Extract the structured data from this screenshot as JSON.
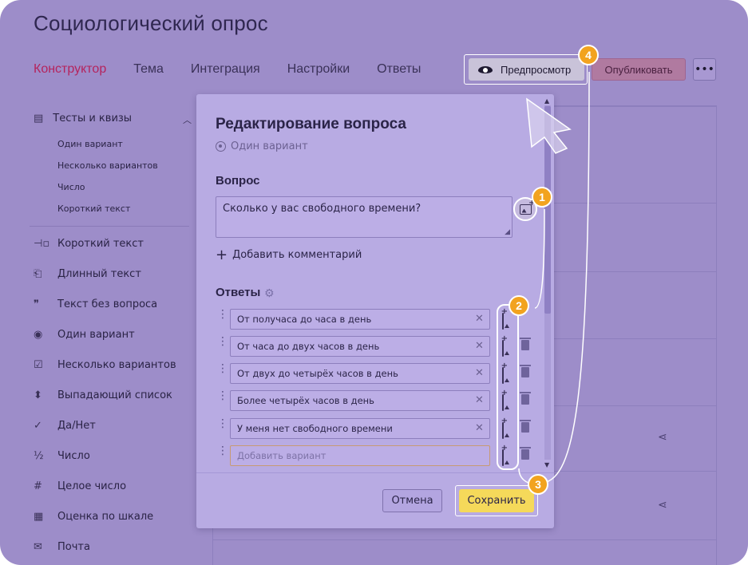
{
  "app": {
    "title": "Социологический опрос"
  },
  "tabs": [
    {
      "label": "Конструктор",
      "active": true
    },
    {
      "label": "Тема"
    },
    {
      "label": "Интеграция"
    },
    {
      "label": "Настройки"
    },
    {
      "label": "Ответы"
    }
  ],
  "toolbar": {
    "preview_label": "Предпросмотр",
    "publish_label": "Опубликовать",
    "more_label": "•••"
  },
  "sidebar": {
    "group_label": "Тесты и квизы",
    "group_items": [
      "Один вариант",
      "Несколько вариантов",
      "Число",
      "Короткий текст"
    ],
    "items": [
      {
        "label": "Короткий текст",
        "icon": "short-text-icon"
      },
      {
        "label": "Длинный текст",
        "icon": "long-text-icon"
      },
      {
        "label": "Текст без вопроса",
        "icon": "quote-icon"
      },
      {
        "label": "Один вариант",
        "icon": "radio-icon"
      },
      {
        "label": "Несколько вариантов",
        "icon": "checkbox-icon"
      },
      {
        "label": "Выпадающий список",
        "icon": "dropdown-icon"
      },
      {
        "label": "Да/Нет",
        "icon": "check-icon"
      },
      {
        "label": "Число",
        "icon": "fraction-icon"
      },
      {
        "label": "Целое число",
        "icon": "hash-icon"
      },
      {
        "label": "Оценка по шкале",
        "icon": "grid-icon"
      },
      {
        "label": "Почта",
        "icon": "mail-icon"
      }
    ]
  },
  "modal": {
    "title": "Редактирование вопроса",
    "type_label": "Один вариант",
    "question_section": "Вопрос",
    "question_text": "Сколько у вас свободного времени?",
    "add_comment": "Добавить комментарий",
    "answers_section": "Ответы",
    "answers": [
      "От получаса до часа в день",
      "От часа до двух часов в день",
      "От двух до четырёх часов в день",
      "Более четырёх часов в день",
      "У меня нет свободного времени"
    ],
    "add_variant_placeholder": "Добавить вариант",
    "cancel_label": "Отмена",
    "save_label": "Сохранить"
  },
  "annotations": {
    "badges": [
      "1",
      "2",
      "3",
      "4"
    ]
  },
  "colors": {
    "accent_tab": "#b5245d",
    "save": "#f5d95a",
    "badge": "#f2a31f",
    "overlay": "#9d8dc9"
  }
}
